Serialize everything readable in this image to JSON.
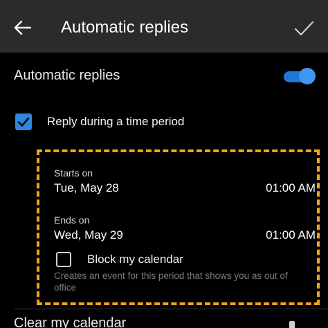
{
  "appbar": {
    "title": "Automatic replies",
    "back_icon": "arrow-left-icon",
    "confirm_icon": "checkmark-icon"
  },
  "automatic_replies": {
    "label": "Automatic replies",
    "enabled": true
  },
  "reply_period": {
    "label": "Reply during a time period",
    "checked": true
  },
  "starts": {
    "caption": "Starts on",
    "date": "Tue, May 28",
    "time": "01:00 AM"
  },
  "ends": {
    "caption": "Ends on",
    "date": "Wed, May 29",
    "time": "01:00 AM"
  },
  "block_calendar": {
    "label": "Block my calendar",
    "checked": false,
    "description": "Creates an event for this period that shows you as out of office"
  },
  "clear_calendar": {
    "label": "Clear my calendar"
  },
  "colors": {
    "appbar_bg": "#2b2b2b",
    "background": "#000000",
    "accent": "#2f86e0",
    "highlight": "#f3a512"
  }
}
